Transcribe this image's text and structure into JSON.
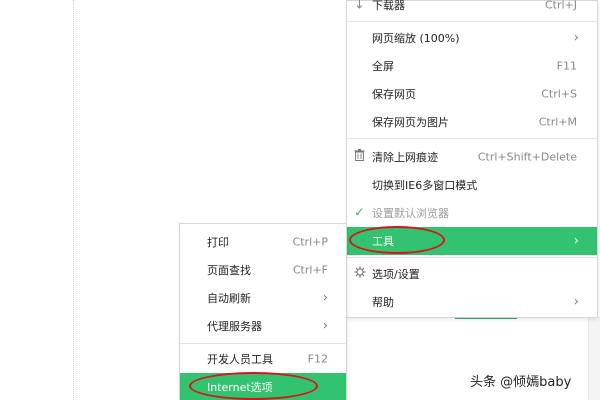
{
  "main_menu": {
    "items": [
      {
        "label": "下载器",
        "shortcut": "Ctrl+J"
      },
      {
        "label": "网页缩放 (100%)",
        "arrow": "›"
      },
      {
        "label": "全屏",
        "shortcut": "F11"
      },
      {
        "label": "保存网页",
        "shortcut": "Ctrl+S"
      },
      {
        "label": "保存网页为图片",
        "shortcut": "Ctrl+M"
      },
      {
        "label": "清除上网痕迹",
        "shortcut": "Ctrl+Shift+Delete",
        "icon": "trash-icon"
      },
      {
        "label": "切换到IE6多窗口模式"
      },
      {
        "label": "设置默认浏览器",
        "icon": "checkmark-icon",
        "disabled": true
      },
      {
        "label": "工具",
        "arrow": "›",
        "active": true
      },
      {
        "label": "选项/设置",
        "icon": "gear-icon"
      },
      {
        "label": "帮助",
        "arrow": "›"
      }
    ]
  },
  "sub_menu": {
    "items": [
      {
        "label": "打印",
        "shortcut": "Ctrl+P"
      },
      {
        "label": "页面查找",
        "shortcut": "Ctrl+F"
      },
      {
        "label": "自动刷新",
        "arrow": "›"
      },
      {
        "label": "代理服务器",
        "arrow": "›"
      },
      {
        "label": "开发人员工具",
        "shortcut": "F12"
      },
      {
        "label": "Internet选项",
        "active": true
      }
    ]
  },
  "watermark": "头条 @倾嫣baby",
  "colors": {
    "active_bg": "#33c26f",
    "highlight_ellipse": "#d8141a"
  }
}
